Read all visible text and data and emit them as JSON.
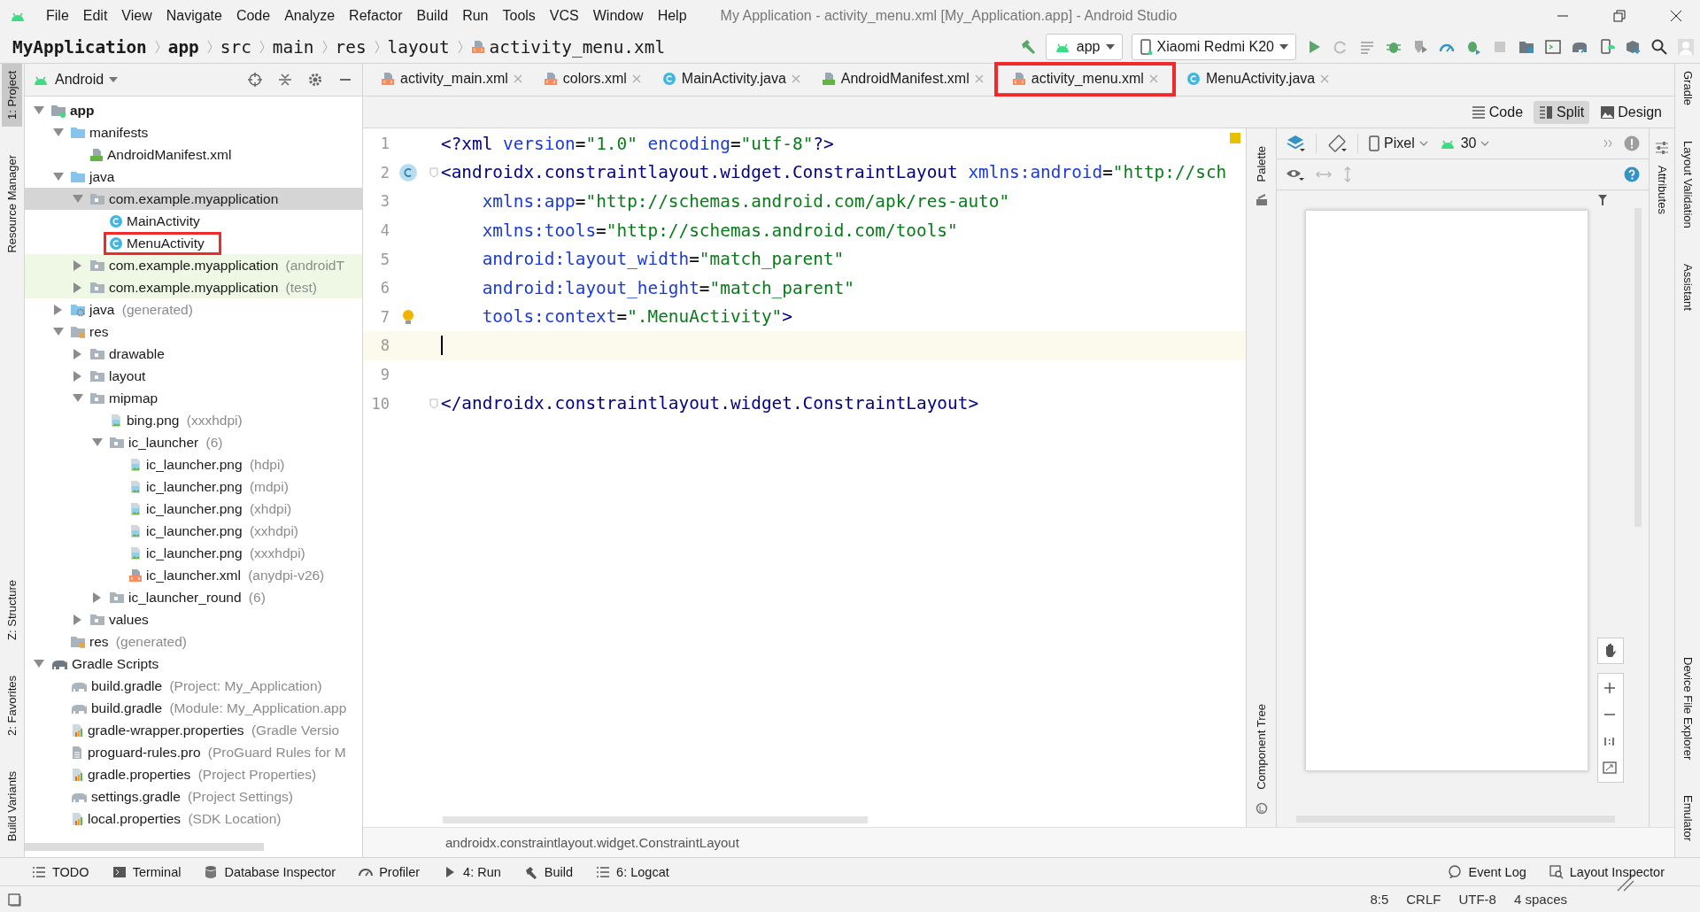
{
  "window": {
    "title": "My Application - activity_menu.xml [My_Application.app] - Android Studio"
  },
  "menu": [
    "File",
    "Edit",
    "View",
    "Navigate",
    "Code",
    "Analyze",
    "Refactor",
    "Build",
    "Run",
    "Tools",
    "VCS",
    "Window",
    "Help"
  ],
  "breadcrumbs": [
    {
      "label": "MyApplication",
      "kind": "bold"
    },
    {
      "label": "app",
      "kind": "bold"
    },
    {
      "label": "src",
      "kind": "plain"
    },
    {
      "label": "main",
      "kind": "plain"
    },
    {
      "label": "res",
      "kind": "plain"
    },
    {
      "label": "layout",
      "kind": "plain"
    },
    {
      "label": "activity_menu.xml",
      "kind": "file"
    }
  ],
  "toolbar": {
    "run_config": "app",
    "device": "Xiaomi Redmi K20"
  },
  "left_strip": {
    "top": [
      {
        "label": "1: Project",
        "selected": true
      },
      {
        "label": "Resource Manager",
        "selected": false
      }
    ],
    "bottom": [
      {
        "label": "Z: Structure",
        "selected": false
      },
      {
        "label": "2: Favorites",
        "selected": false
      },
      {
        "label": "Build Variants",
        "selected": false
      }
    ]
  },
  "right_strip": {
    "top": [
      {
        "label": "Gradle",
        "selected": false
      },
      {
        "label": "Layout Validation",
        "selected": false
      },
      {
        "label": "Assistant",
        "selected": false
      }
    ],
    "bottom": [
      {
        "label": "Device File Explorer",
        "selected": false
      },
      {
        "label": "Emulator",
        "selected": false
      }
    ]
  },
  "project": {
    "view": "Android",
    "tree": [
      {
        "label": "app",
        "kind": "module",
        "expanded": true,
        "selected": false,
        "children": [
          {
            "label": "manifests",
            "kind": "source-folder",
            "expanded": true,
            "selected": false,
            "children": [
              {
                "label": "AndroidManifest.xml",
                "kind": "manifest",
                "selected": false
              }
            ]
          },
          {
            "label": "java",
            "kind": "source-folder",
            "expanded": true,
            "selected": false,
            "children": [
              {
                "label": "com.example.myapplication",
                "kind": "package",
                "expanded": true,
                "selected": true,
                "children": [
                  {
                    "label": "MainActivity",
                    "kind": "class",
                    "selected": false
                  },
                  {
                    "label": "MenuActivity",
                    "kind": "class",
                    "selected": false,
                    "annotated": true
                  }
                ]
              },
              {
                "label": "com.example.myapplication",
                "note": "(androidT",
                "kind": "package",
                "expanded": false,
                "selected": false,
                "test": true
              },
              {
                "label": "com.example.myapplication",
                "note": "(test)",
                "kind": "package",
                "expanded": false,
                "selected": false,
                "test": true
              }
            ]
          },
          {
            "label": "java",
            "note": "(generated)",
            "kind": "generated",
            "expanded": false,
            "selected": false
          },
          {
            "label": "res",
            "kind": "resources",
            "expanded": true,
            "selected": false,
            "children": [
              {
                "label": "drawable",
                "kind": "package",
                "expanded": false,
                "selected": false
              },
              {
                "label": "layout",
                "kind": "package",
                "expanded": false,
                "selected": false
              },
              {
                "label": "mipmap",
                "kind": "package",
                "expanded": true,
                "selected": false,
                "children": [
                  {
                    "label": "bing.png",
                    "note": "(xxxhdpi)",
                    "kind": "image",
                    "selected": false
                  },
                  {
                    "label": "ic_launcher",
                    "note": "(6)",
                    "kind": "package",
                    "expanded": true,
                    "selected": false,
                    "children": [
                      {
                        "label": "ic_launcher.png",
                        "note": "(hdpi)",
                        "kind": "image",
                        "selected": false
                      },
                      {
                        "label": "ic_launcher.png",
                        "note": "(mdpi)",
                        "kind": "image",
                        "selected": false
                      },
                      {
                        "label": "ic_launcher.png",
                        "note": "(xhdpi)",
                        "kind": "image",
                        "selected": false
                      },
                      {
                        "label": "ic_launcher.png",
                        "note": "(xxhdpi)",
                        "kind": "image",
                        "selected": false
                      },
                      {
                        "label": "ic_launcher.png",
                        "note": "(xxxhdpi)",
                        "kind": "image",
                        "selected": false
                      },
                      {
                        "label": "ic_launcher.xml",
                        "note": "(anydpi-v26)",
                        "kind": "xml",
                        "selected": false
                      }
                    ]
                  },
                  {
                    "label": "ic_launcher_round",
                    "note": "(6)",
                    "kind": "package",
                    "expanded": false,
                    "selected": false
                  }
                ]
              },
              {
                "label": "values",
                "kind": "package",
                "expanded": false,
                "selected": false
              }
            ]
          },
          {
            "label": "res",
            "note": "(generated)",
            "kind": "resources",
            "selected": false
          }
        ]
      },
      {
        "label": "Gradle Scripts",
        "kind": "gradle",
        "expanded": true,
        "selected": false,
        "children": [
          {
            "label": "build.gradle",
            "note": "(Project: My_Application)",
            "kind": "gradle-file",
            "selected": false
          },
          {
            "label": "build.gradle",
            "note": "(Module: My_Application.app",
            "kind": "gradle-file",
            "selected": false
          },
          {
            "label": "gradle-wrapper.properties",
            "note": "(Gradle Versio",
            "kind": "properties",
            "selected": false
          },
          {
            "label": "proguard-rules.pro",
            "note": "(ProGuard Rules for M",
            "kind": "text",
            "selected": false
          },
          {
            "label": "gradle.properties",
            "note": "(Project Properties)",
            "kind": "properties",
            "selected": false
          },
          {
            "label": "settings.gradle",
            "note": "(Project Settings)",
            "kind": "gradle-file",
            "selected": false
          },
          {
            "label": "local.properties",
            "note": "(SDK Location)",
            "kind": "properties",
            "selected": false
          }
        ]
      }
    ]
  },
  "editor_tabs": [
    {
      "label": "activity_main.xml",
      "kind": "xml",
      "selected": false
    },
    {
      "label": "colors.xml",
      "kind": "xml",
      "selected": false
    },
    {
      "label": "MainActivity.java",
      "kind": "class",
      "selected": false
    },
    {
      "label": "AndroidManifest.xml",
      "kind": "manifest",
      "selected": false
    },
    {
      "label": "activity_menu.xml",
      "kind": "xml",
      "selected": true,
      "annotated": true
    },
    {
      "label": "MenuActivity.java",
      "kind": "class",
      "selected": false
    }
  ],
  "view_modes": [
    {
      "label": "Code",
      "selected": false
    },
    {
      "label": "Split",
      "selected": true
    },
    {
      "label": "Design",
      "selected": false
    }
  ],
  "code": [
    {
      "number": "1",
      "tokens": [
        {
          "kind": "tag",
          "text": "<?xml"
        },
        {
          "kind": "attr",
          "text": " version"
        },
        {
          "kind": "plain",
          "text": "="
        },
        {
          "kind": "value",
          "text": "\"1.0\""
        },
        {
          "kind": "attr",
          "text": " encoding"
        },
        {
          "kind": "plain",
          "text": "="
        },
        {
          "kind": "value",
          "text": "\"utf-8\""
        },
        {
          "kind": "tag",
          "text": "?>"
        }
      ]
    },
    {
      "number": "2",
      "kind": "declaration",
      "fold": true,
      "tokens": [
        {
          "kind": "tag",
          "text": "<androidx.constraintlayout.widget.ConstraintLayout"
        },
        {
          "kind": "attr",
          "text": " xmlns:android"
        },
        {
          "kind": "plain",
          "text": "="
        },
        {
          "kind": "value",
          "text": "\"http://sch"
        }
      ]
    },
    {
      "number": "3",
      "indent": true,
      "tokens": [
        {
          "kind": "attr",
          "text": "xmlns:app"
        },
        {
          "kind": "plain",
          "text": "="
        },
        {
          "kind": "value",
          "text": "\"http://schemas.android.com/apk/res-auto\""
        }
      ]
    },
    {
      "number": "4",
      "indent": true,
      "tokens": [
        {
          "kind": "attr",
          "text": "xmlns:tools"
        },
        {
          "kind": "plain",
          "text": "="
        },
        {
          "kind": "value",
          "text": "\"http://schemas.android.com/tools\""
        }
      ]
    },
    {
      "number": "5",
      "indent": true,
      "tokens": [
        {
          "kind": "attr",
          "text": "android:layout_width"
        },
        {
          "kind": "plain",
          "text": "="
        },
        {
          "kind": "value",
          "text": "\"match_parent\""
        }
      ]
    },
    {
      "number": "6",
      "indent": true,
      "tokens": [
        {
          "kind": "attr",
          "text": "android:layout_height"
        },
        {
          "kind": "plain",
          "text": "="
        },
        {
          "kind": "value",
          "text": "\"match_parent\""
        }
      ]
    },
    {
      "number": "7",
      "indent": true,
      "kind": "hint",
      "tokens": [
        {
          "kind": "attr",
          "text": "tools:context"
        },
        {
          "kind": "plain",
          "text": "="
        },
        {
          "kind": "value",
          "text": "\".MenuActivity\""
        },
        {
          "kind": "tag",
          "text": ">"
        }
      ]
    },
    {
      "number": "8",
      "current": true
    },
    {
      "number": "9"
    },
    {
      "number": "10",
      "fold": true,
      "tokens": [
        {
          "kind": "tag",
          "text": "</androidx.constraintlayout.widget.ConstraintLayout>"
        }
      ]
    }
  ],
  "editor_breadcrumb": "androidx.constraintlayout.widget.ConstraintLayout",
  "design": {
    "palette": "Palette",
    "component_tree": "Component Tree",
    "attributes": "Attributes",
    "device": "Pixel",
    "api": "30"
  },
  "bottom_tools": {
    "left": [
      {
        "label": "TODO",
        "kind": "list"
      },
      {
        "label": "Terminal",
        "kind": "terminal"
      },
      {
        "label": "Database Inspector",
        "kind": "database"
      },
      {
        "label": "Profiler",
        "kind": "gauge"
      },
      {
        "label": "4: Run",
        "kind": "run"
      },
      {
        "label": "Build",
        "kind": "hammer"
      },
      {
        "label": "6: Logcat",
        "kind": "list"
      }
    ],
    "right": [
      {
        "label": "Event Log",
        "kind": "bubble"
      },
      {
        "label": "Layout Inspector",
        "kind": "inspect"
      }
    ]
  },
  "status_bar": [
    "8:5",
    "CRLF",
    "UTF-8",
    "4 spaces"
  ]
}
